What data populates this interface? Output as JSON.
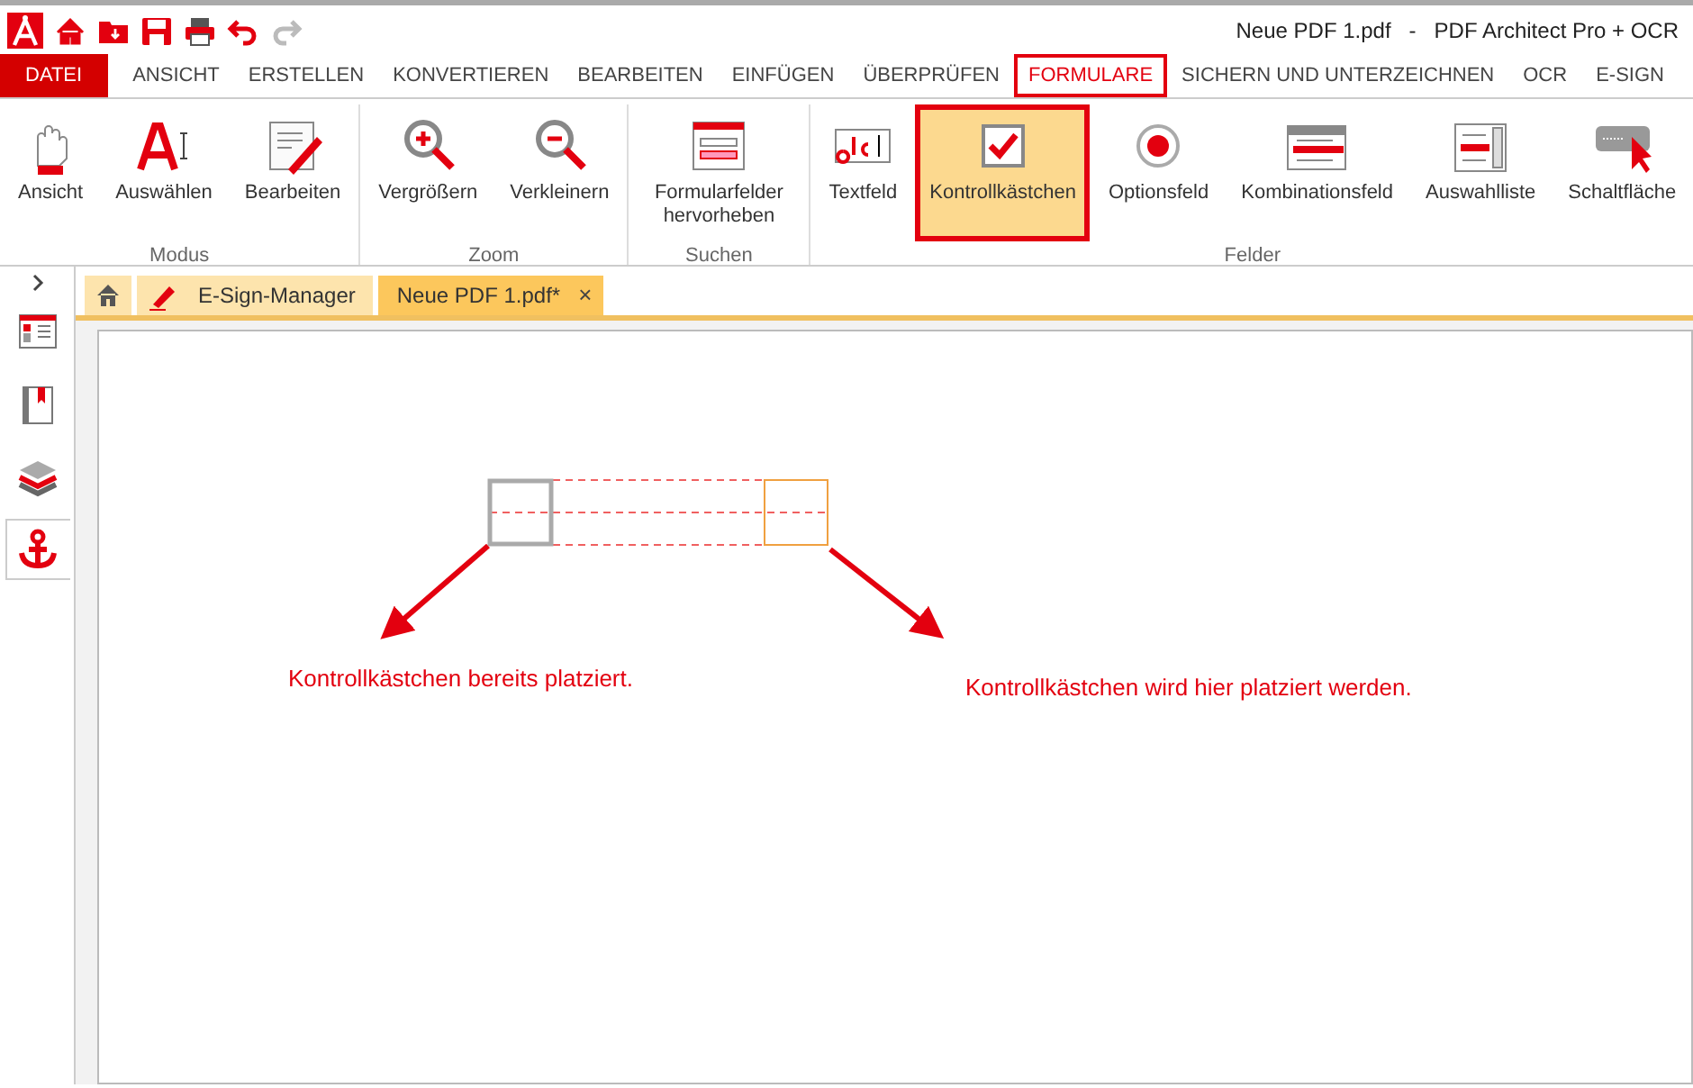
{
  "window": {
    "title": "Neue PDF 1.pdf   -   PDF Architect Pro + OCR"
  },
  "quick_access": [
    {
      "kind": "home"
    },
    {
      "kind": "folder"
    },
    {
      "kind": "save"
    },
    {
      "kind": "print"
    },
    {
      "kind": "undo",
      "disabled": false
    },
    {
      "kind": "redo",
      "disabled": true
    }
  ],
  "menu": [
    {
      "label": "DATEI",
      "kind": "file",
      "selected": false
    },
    {
      "label": "ANSICHT",
      "selected": false
    },
    {
      "label": "ERSTELLEN",
      "selected": false
    },
    {
      "label": "KONVERTIEREN",
      "selected": false
    },
    {
      "label": "BEARBEITEN",
      "selected": false
    },
    {
      "label": "EINFÜGEN",
      "selected": false
    },
    {
      "label": "ÜBERPRÜFEN",
      "selected": false
    },
    {
      "label": "FORMULARE",
      "selected": true
    },
    {
      "label": "SICHERN UND UNTERZEICHNEN",
      "selected": false
    },
    {
      "label": "OCR",
      "selected": false
    },
    {
      "label": "E-SIGN",
      "selected": false
    }
  ],
  "ribbon": [
    {
      "label": "Modus",
      "buttons": [
        {
          "label": "Ansicht",
          "kind": "hand",
          "selected": false
        },
        {
          "label": "Auswählen",
          "kind": "select",
          "selected": false
        },
        {
          "label": "Bearbeiten",
          "kind": "edit",
          "selected": false
        }
      ]
    },
    {
      "label": "Zoom",
      "buttons": [
        {
          "label": "Vergrößern",
          "kind": "zoomin",
          "selected": false
        },
        {
          "label": "Verkleinern",
          "kind": "zoomout",
          "selected": false
        }
      ]
    },
    {
      "label": "Suchen",
      "buttons": [
        {
          "label": "Formularfelder hervorheben",
          "kind": "highlight",
          "selected": false
        }
      ]
    },
    {
      "label": "Felder",
      "buttons": [
        {
          "label": "Textfeld",
          "kind": "textfield",
          "selected": false
        },
        {
          "label": "Kontrollkästchen",
          "kind": "checkbox",
          "selected": true
        },
        {
          "label": "Optionsfeld",
          "kind": "radio",
          "selected": false
        },
        {
          "label": "Kombinationsfeld",
          "kind": "combo",
          "selected": false
        },
        {
          "label": "Auswahlliste",
          "kind": "list",
          "selected": false
        },
        {
          "label": "Schaltfläche",
          "kind": "button",
          "selected": false
        }
      ]
    }
  ],
  "sidebar": [
    {
      "kind": "pages",
      "selected": false
    },
    {
      "kind": "bookmarks",
      "selected": false
    },
    {
      "kind": "layers",
      "selected": false
    },
    {
      "kind": "anchor",
      "selected": true
    }
  ],
  "doc_tabs": [
    {
      "kind": "home",
      "selected": false
    },
    {
      "kind": "esign",
      "label": "E-Sign-Manager",
      "selected": false
    },
    {
      "kind": "file",
      "label": "Neue PDF 1.pdf*",
      "close": "×",
      "selected": true
    }
  ],
  "placed_checkbox": {
    "checked": false
  },
  "annotations": [
    {
      "text": "Kontrollkästchen bereits platziert."
    },
    {
      "text": "Kontrollkästchen wird hier platziert werden."
    }
  ]
}
